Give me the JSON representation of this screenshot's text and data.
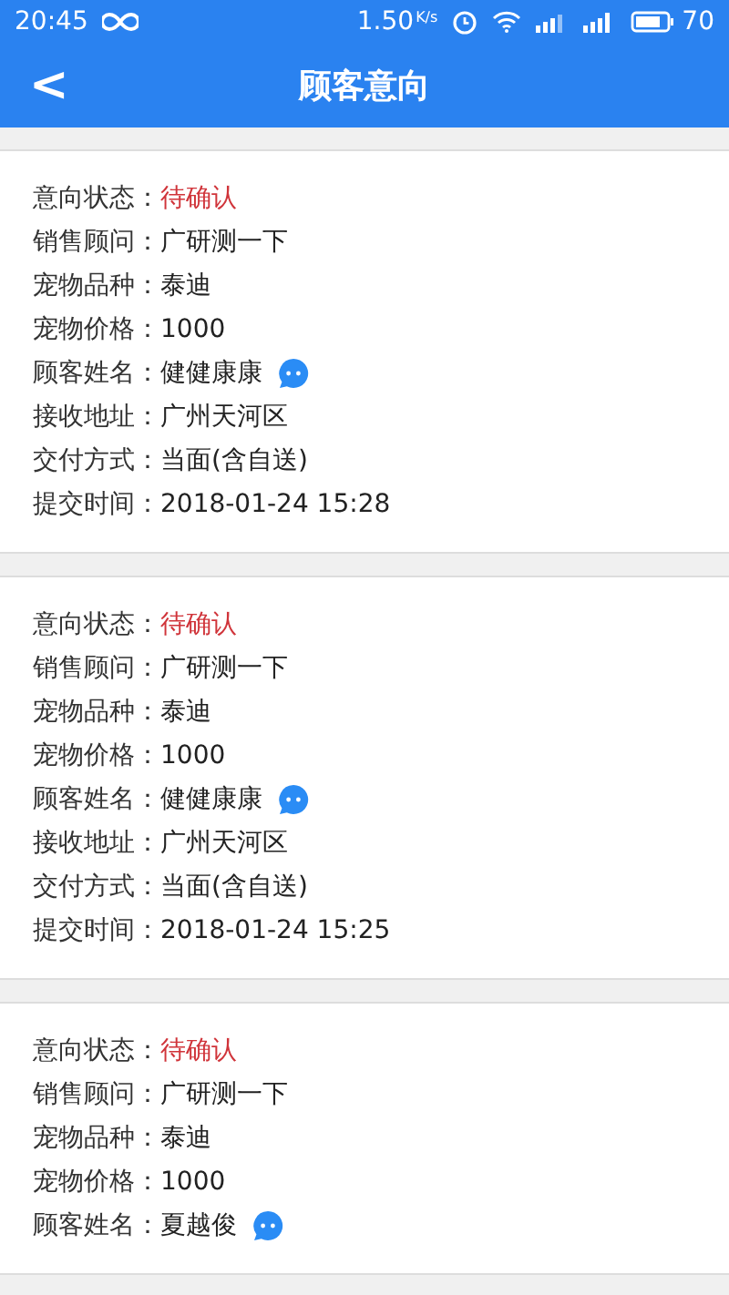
{
  "status_bar": {
    "time": "20:45",
    "speed": "1.50",
    "speed_unit": "K/s",
    "battery": "70"
  },
  "header": {
    "back": "<",
    "title": "顾客意向"
  },
  "cards": [
    {
      "rows": [
        {
          "kind": "status",
          "label": "意向状态：",
          "value": "待确认"
        },
        {
          "kind": "text",
          "label": "销售顾问：",
          "value": "广研测一下"
        },
        {
          "kind": "text",
          "label": "宠物品种：",
          "value": "泰迪"
        },
        {
          "kind": "text",
          "label": "宠物价格：",
          "value": "1000"
        },
        {
          "kind": "contact",
          "label": "顾客姓名：",
          "value": "健健康康"
        },
        {
          "kind": "text",
          "label": "接收地址：",
          "value": "广州天河区"
        },
        {
          "kind": "text",
          "label": "交付方式：",
          "value": "当面(含自送)"
        },
        {
          "kind": "text",
          "label": "提交时间：",
          "value": "2018-01-24 15:28"
        }
      ]
    },
    {
      "rows": [
        {
          "kind": "status",
          "label": "意向状态：",
          "value": "待确认"
        },
        {
          "kind": "text",
          "label": "销售顾问：",
          "value": "广研测一下"
        },
        {
          "kind": "text",
          "label": "宠物品种：",
          "value": "泰迪"
        },
        {
          "kind": "text",
          "label": "宠物价格：",
          "value": "1000"
        },
        {
          "kind": "contact",
          "label": "顾客姓名：",
          "value": "健健康康"
        },
        {
          "kind": "text",
          "label": "接收地址：",
          "value": "广州天河区"
        },
        {
          "kind": "text",
          "label": "交付方式：",
          "value": "当面(含自送)"
        },
        {
          "kind": "text",
          "label": "提交时间：",
          "value": "2018-01-24 15:25"
        }
      ]
    },
    {
      "rows": [
        {
          "kind": "status",
          "label": "意向状态：",
          "value": "待确认"
        },
        {
          "kind": "text",
          "label": "销售顾问：",
          "value": "广研测一下"
        },
        {
          "kind": "text",
          "label": "宠物品种：",
          "value": "泰迪"
        },
        {
          "kind": "text",
          "label": "宠物价格：",
          "value": "1000"
        },
        {
          "kind": "contact",
          "label": "顾客姓名：",
          "value": "夏越俊"
        }
      ]
    }
  ]
}
